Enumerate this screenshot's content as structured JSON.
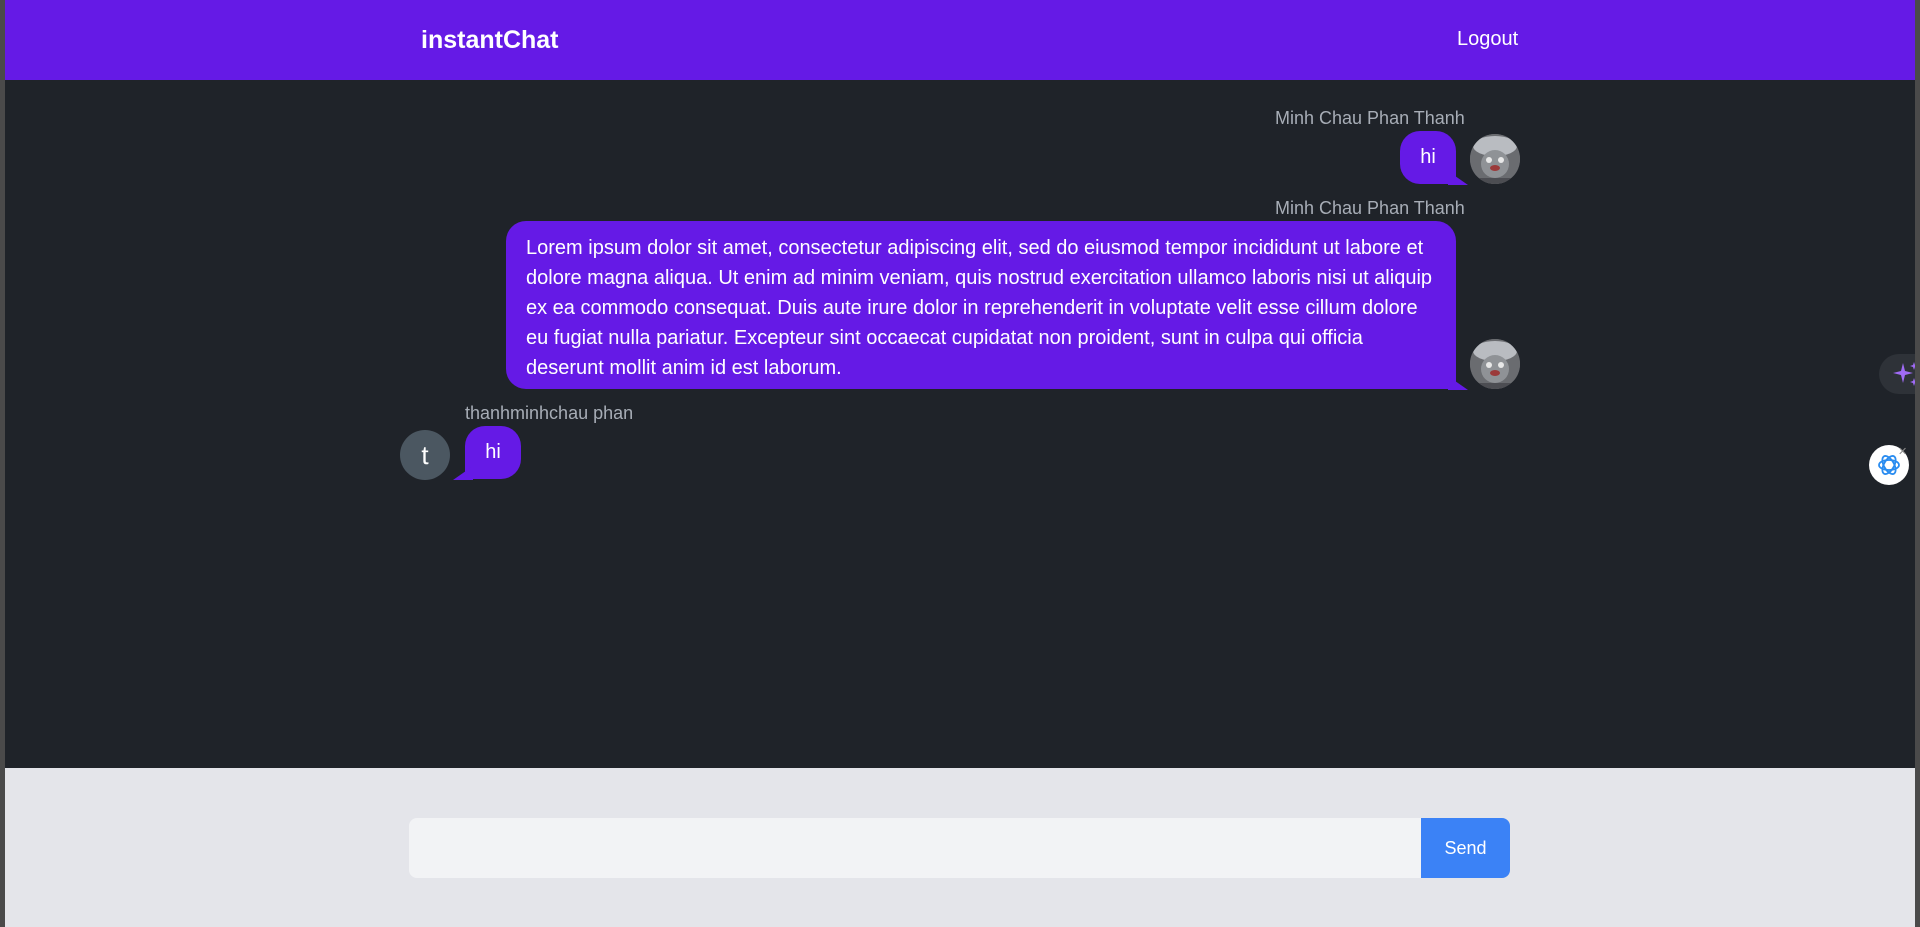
{
  "header": {
    "brand": "instantChat",
    "logout_label": "Logout"
  },
  "messages": [
    {
      "sender": "Minh Chau Phan Thanh",
      "text": "hi",
      "own": true,
      "avatar": "profile-photo"
    },
    {
      "sender": "Minh Chau Phan Thanh",
      "text": "Lorem ipsum dolor sit amet, consectetur adipiscing elit, sed do eiusmod tempor incididunt ut labore et dolore magna aliqua. Ut enim ad minim veniam, quis nostrud exercitation ullamco laboris nisi ut aliquip ex ea commodo consequat. Duis aute irure dolor in reprehenderit in voluptate velit esse cillum dolore eu fugiat nulla pariatur. Excepteur sint occaecat cupidatat non proident, sunt in culpa qui officia deserunt mollit anim id est laborum.",
      "own": true,
      "avatar": "profile-photo"
    },
    {
      "sender": "thanhminhchau phan",
      "text": "hi",
      "own": false,
      "avatar_letter": "t"
    }
  ],
  "composer": {
    "input_value": "",
    "input_placeholder": "",
    "send_label": "Send"
  },
  "widgets": {
    "sparkle_icon": "sparkle-icon",
    "assistant_icon": "openai-icon",
    "close_glyph": "✕"
  },
  "colors": {
    "header": "#651ae6",
    "bubble": "#651ae6",
    "chat_background": "#1f2329",
    "footer": "#e4e5ea",
    "send_button": "#3b82f6",
    "letter_avatar": "#4b5761"
  }
}
